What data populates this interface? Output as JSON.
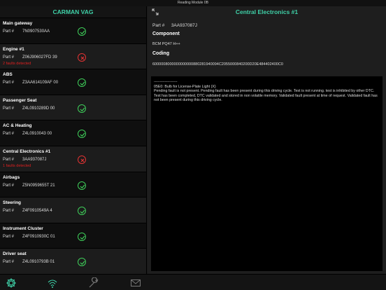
{
  "statusbar": {
    "title": "Reading Module 0B"
  },
  "left": {
    "title": "CARMAN VAG",
    "part_label": "Part #",
    "modules": [
      {
        "name": "Main gateway",
        "part": "7N0907530AA",
        "status": "ok",
        "fault": ""
      },
      {
        "name": "Engine #1",
        "part": "Z06J906027FD 39",
        "status": "err",
        "fault": "2 faults detected"
      },
      {
        "name": "ABS",
        "part": "Z3AA614109AF 00",
        "status": "ok",
        "fault": ""
      },
      {
        "name": "Passenger Seat",
        "part": "Z4L0910289D 00",
        "status": "ok",
        "fault": ""
      },
      {
        "name": "AC & Heating",
        "part": "Z4L0910043 00",
        "status": "ok",
        "fault": ""
      },
      {
        "name": "Central Electronics #1",
        "part": "3AA937087J",
        "status": "err",
        "fault": "1 faults detected"
      },
      {
        "name": "Airbags",
        "part": "Z5N0959655T 21",
        "status": "ok",
        "fault": ""
      },
      {
        "name": "Steering",
        "part": "Z4F0910549A 4",
        "status": "ok",
        "fault": ""
      },
      {
        "name": "Instrument Cluster",
        "part": "Z4F0910930C 01",
        "status": "ok",
        "fault": ""
      },
      {
        "name": "Driver seat",
        "part": "Z4L0910793B 01",
        "status": "ok",
        "fault": ""
      }
    ]
  },
  "right": {
    "title": "Central Electronics #1",
    "part_label": "Part #",
    "part": "3AA937087J",
    "component_label": "Component",
    "component": "BCM PQ47 H++",
    "coding_label": "Coding",
    "coding": "6000008000000000000880281940094C2055000840200D20E484402400C0",
    "fault_lines": [
      "-------------------",
      "05E0: Bulb for License-Plate Light (X)",
      " Pending fault is not present. Pending fault has been present during this driving cycle. Test is not running. test is inhibited by other DTC. Test has been completed, DTC validated and stored in non volatile memory. Validated fault present at time of request. Validated fault has not been present during this driving cycle."
    ]
  },
  "tabbar": {
    "icons": [
      "gear-icon",
      "wifi-icon",
      "wrench-icon",
      "mail-icon"
    ],
    "accent": "#3fd1a8",
    "ok_color": "#3fcf5a",
    "err_color": "#e23333"
  }
}
